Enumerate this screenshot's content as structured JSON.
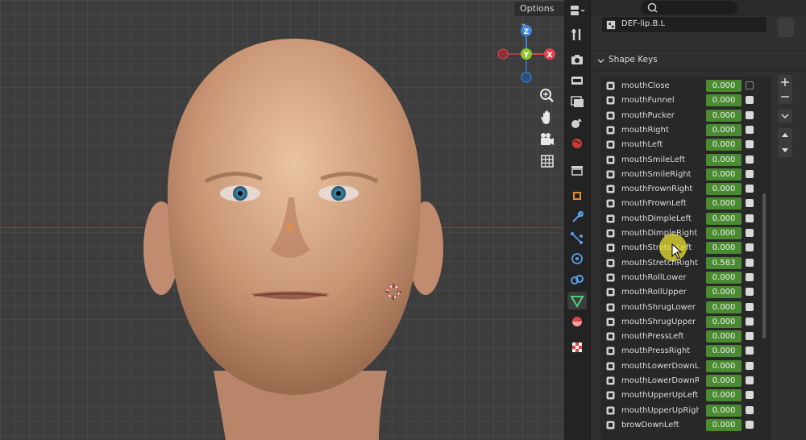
{
  "viewport": {
    "options_label": "Options",
    "gizmo_axes": {
      "z": "Z",
      "y": "Y",
      "x": "X"
    },
    "axis_colors": {
      "x": "#e0434f",
      "y": "#8fc72b",
      "z": "#3c86de"
    },
    "tools": [
      "zoom-icon",
      "hand-icon",
      "camera-icon",
      "grid-icon"
    ]
  },
  "properties_tabs": [
    "tool-icon",
    "render-icon",
    "output-icon",
    "view-layer-icon",
    "scene-icon",
    "world-icon",
    "collection-icon",
    "object-icon",
    "modifier-icon",
    "particles-icon",
    "physics-icon",
    "constraints-icon",
    "data-icon",
    "material-icon",
    "texture-icon"
  ],
  "editor": {
    "bone_field": "DEF-lip.B.L",
    "shape_keys_title": "Shape Keys",
    "accent_value_color": "#4a8a30",
    "shape_keys": [
      {
        "name": "mouthClose",
        "value": "0.000",
        "enabled": false
      },
      {
        "name": "mouthFunnel",
        "value": "0.000",
        "enabled": true
      },
      {
        "name": "mouthPucker",
        "value": "0.000",
        "enabled": true
      },
      {
        "name": "mouthRight",
        "value": "0.000",
        "enabled": true
      },
      {
        "name": "mouthLeft",
        "value": "0.000",
        "enabled": true
      },
      {
        "name": "mouthSmileLeft",
        "value": "0.000",
        "enabled": true
      },
      {
        "name": "mouthSmileRight",
        "value": "0.000",
        "enabled": true
      },
      {
        "name": "mouthFrownRight",
        "value": "0.000",
        "enabled": true
      },
      {
        "name": "mouthFrownLeft",
        "value": "0.000",
        "enabled": true
      },
      {
        "name": "mouthDimpleLeft",
        "value": "0.000",
        "enabled": true
      },
      {
        "name": "mouthDimpleRight",
        "value": "0.000",
        "enabled": true
      },
      {
        "name": "mouthStretchLeft",
        "value": "0.000",
        "enabled": true
      },
      {
        "name": "mouthStretchRight",
        "value": "0.583",
        "enabled": true
      },
      {
        "name": "mouthRollLower",
        "value": "0.000",
        "enabled": true
      },
      {
        "name": "mouthRollUpper",
        "value": "0.000",
        "enabled": true
      },
      {
        "name": "mouthShrugLower",
        "value": "0.000",
        "enabled": true
      },
      {
        "name": "mouthShrugUpper",
        "value": "0.000",
        "enabled": true
      },
      {
        "name": "mouthPressLeft",
        "value": "0.000",
        "enabled": true
      },
      {
        "name": "mouthPressRight",
        "value": "0.000",
        "enabled": true
      },
      {
        "name": "mouthLowerDownLeft",
        "value": "0.000",
        "enabled": true
      },
      {
        "name": "mouthLowerDownRight",
        "value": "0.000",
        "enabled": true
      },
      {
        "name": "mouthUpperUpLeft",
        "value": "0.000",
        "enabled": true
      },
      {
        "name": "mouthUpperUpRight",
        "value": "0.000",
        "enabled": true
      },
      {
        "name": "browDownLeft",
        "value": "0.000",
        "enabled": true
      }
    ]
  }
}
